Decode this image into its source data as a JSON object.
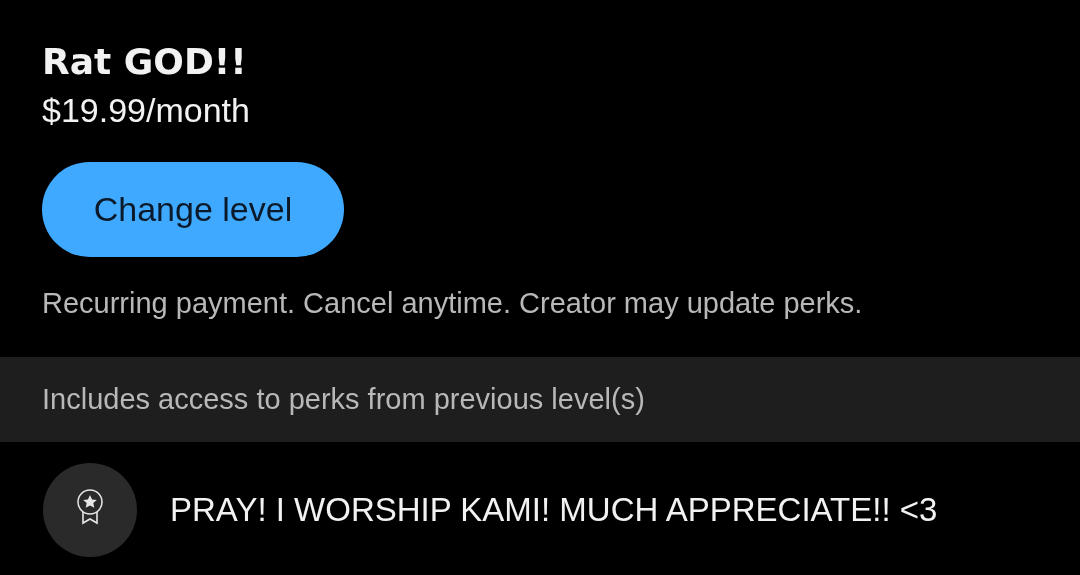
{
  "tier": {
    "title": "Rat GOD!!",
    "price": "$19.99/month"
  },
  "change_button": {
    "label": "Change level"
  },
  "note": "Recurring payment. Cancel anytime. Creator may update perks.",
  "includes_banner": "Includes access to perks from previous level(s)",
  "perks": [
    {
      "text": "PRAY! I WORSHIP KAMI! MUCH APPRECIATE!! <3"
    }
  ]
}
